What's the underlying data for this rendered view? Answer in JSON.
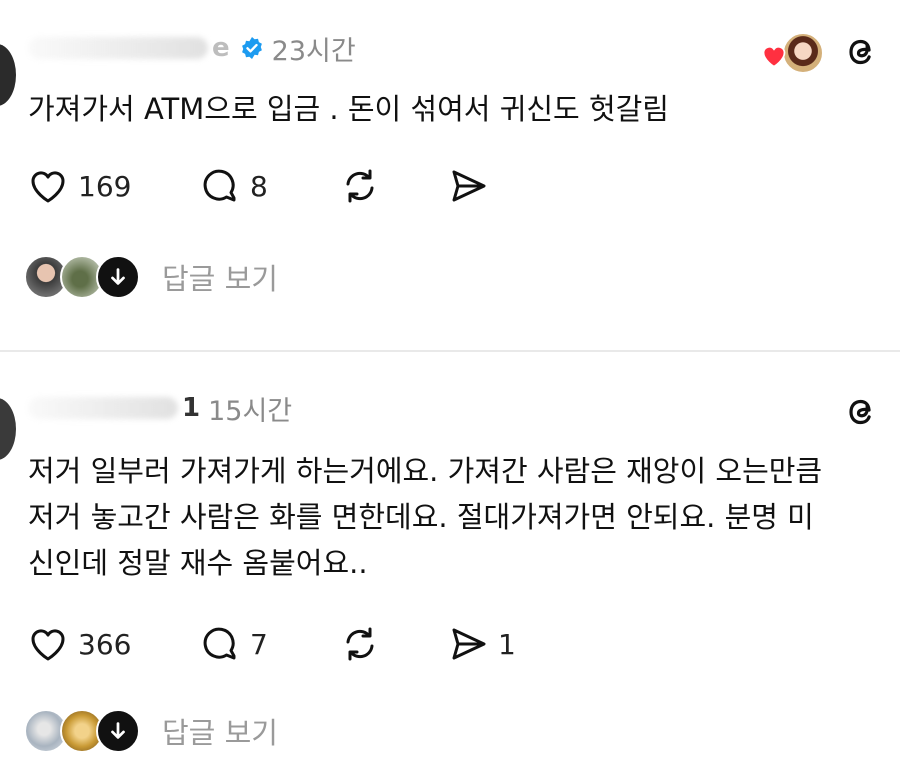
{
  "posts": [
    {
      "username_suffix": "e",
      "time": "23시간",
      "text": "가져가서 ATM으로 입금 . 돈이 섞여서 귀신도 헛갈림",
      "likes": "169",
      "replies": "8",
      "reposts": "",
      "shares": "",
      "view_replies_label": "답글 보기",
      "liked_by_author": true
    },
    {
      "username_suffix": "1",
      "time": "15시간",
      "text_lines": [
        "저거 일부러 가져가게 하는거에요. 가져간 사람은 재앙이 오는만큼",
        "저거 놓고간 사람은 화를 면한데요. 절대가져가면 안되요. 분명 미",
        "신인데 정말 재수 옴붙어요.."
      ],
      "likes": "366",
      "replies": "7",
      "reposts": "",
      "shares": "1",
      "view_replies_label": "답글 보기"
    }
  ],
  "icons": {
    "verified": "verified-badge-icon",
    "threads": "threads-logo-icon",
    "like": "heart-icon",
    "reply": "comment-bubble-icon",
    "repost": "repost-icon",
    "share": "share-send-icon",
    "expand": "arrow-down-icon"
  },
  "colors": {
    "verified_blue": "#1d9bf0",
    "heart_red": "#ff3040",
    "muted_text": "#8a8a8a"
  }
}
